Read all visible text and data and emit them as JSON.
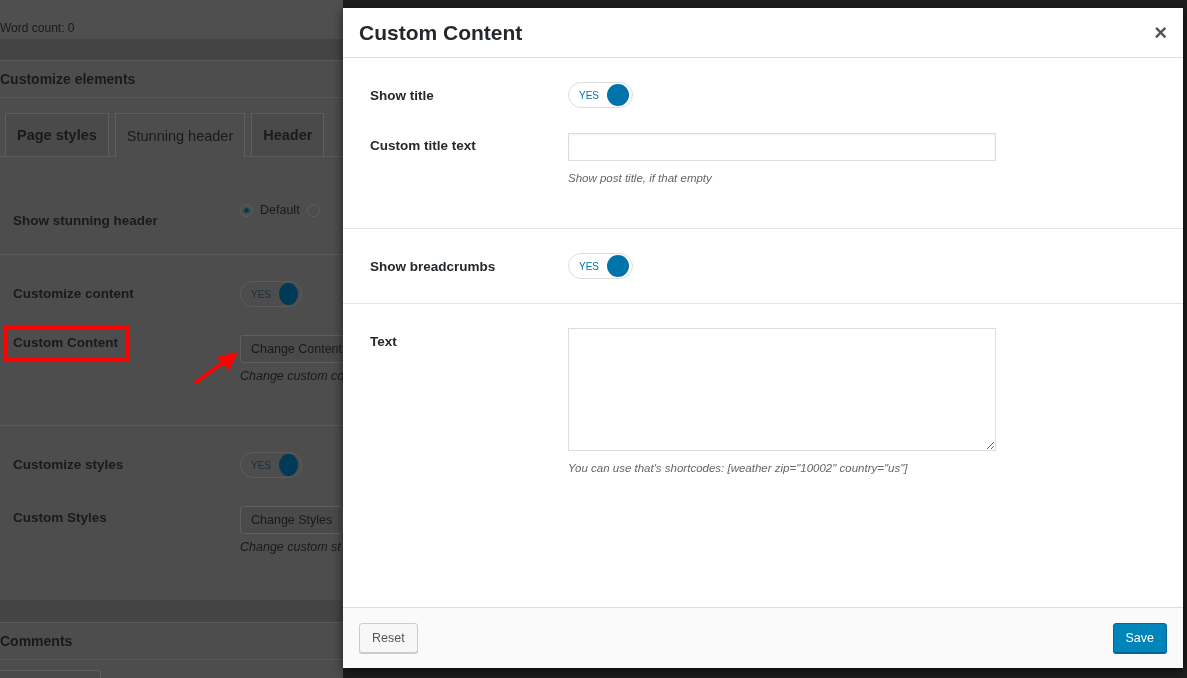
{
  "background_page": {
    "word_count": "Word count: 0",
    "section_title": "Customize elements",
    "tabs": [
      {
        "label": "Page styles",
        "selected": false
      },
      {
        "label": "Stunning header",
        "selected": true
      },
      {
        "label": "Header",
        "selected": false
      }
    ],
    "rows": [
      {
        "kind": "radio",
        "label": "Show stunning header",
        "options": [
          {
            "label": "Default",
            "selected": true
          },
          {
            "selected": false
          }
        ]
      },
      {
        "kind": "toggle",
        "label": "Customize content",
        "on": true,
        "text": "YES"
      },
      {
        "kind": "button",
        "label": "Custom Content",
        "button": "Change Content",
        "hint": "Change custom co",
        "highlighted": true
      },
      {
        "kind": "toggle",
        "label": "Customize styles",
        "on": true,
        "text": "YES"
      },
      {
        "kind": "button",
        "label": "Custom Styles",
        "button": "Change Styles",
        "hint": "Change custom st",
        "highlighted": false
      }
    ],
    "comments_title": "Comments"
  },
  "modal": {
    "title": "Custom Content",
    "close": "×",
    "sections": [
      [
        {
          "kind": "toggle",
          "label": "Show title",
          "on": true,
          "text": "YES"
        },
        {
          "kind": "input",
          "label": "Custom title text",
          "hint": "Show post title, if that empty"
        }
      ],
      [
        {
          "kind": "toggle",
          "label": "Show breadcrumbs",
          "on": true,
          "text": "YES"
        }
      ],
      [
        {
          "kind": "textarea",
          "label": "Text",
          "hint": "You can use that's shortcodes: [weather zip=\"10002\" country=\"us\"]"
        }
      ]
    ],
    "buttons": {
      "reset": "Reset",
      "save": "Save"
    }
  }
}
